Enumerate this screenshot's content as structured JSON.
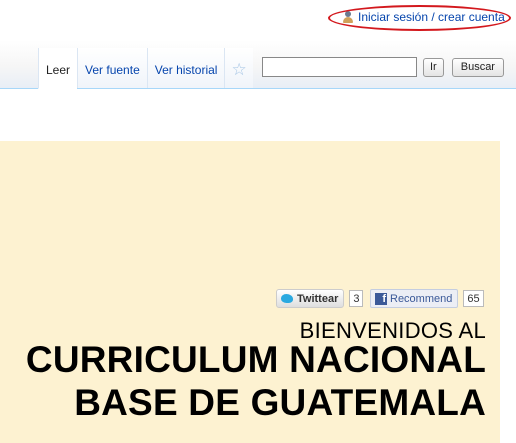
{
  "personal": {
    "login_link": "Iniciar sesión / crear cuenta",
    "icon": "user-icon"
  },
  "tabs": [
    {
      "label": "Leer",
      "selected": true
    },
    {
      "label": "Ver fuente",
      "selected": false
    },
    {
      "label": "Ver historial",
      "selected": false
    }
  ],
  "watch_icon": "star-icon",
  "search": {
    "value": "",
    "go_label": "Ir",
    "search_label": "Buscar"
  },
  "social": {
    "twitter_label": "Twittear",
    "twitter_count": "3",
    "facebook_label": "Recommend",
    "facebook_count": "65"
  },
  "banner": {
    "welcome": "BIENVENIDOS AL",
    "title_line1": "CURRICULUM NACIONAL",
    "title_line2": "BASE DE GUATEMALA"
  },
  "colors": {
    "link": "#0645ad",
    "banner_bg": "#fdf2d1",
    "highlight": "#d3181d"
  }
}
